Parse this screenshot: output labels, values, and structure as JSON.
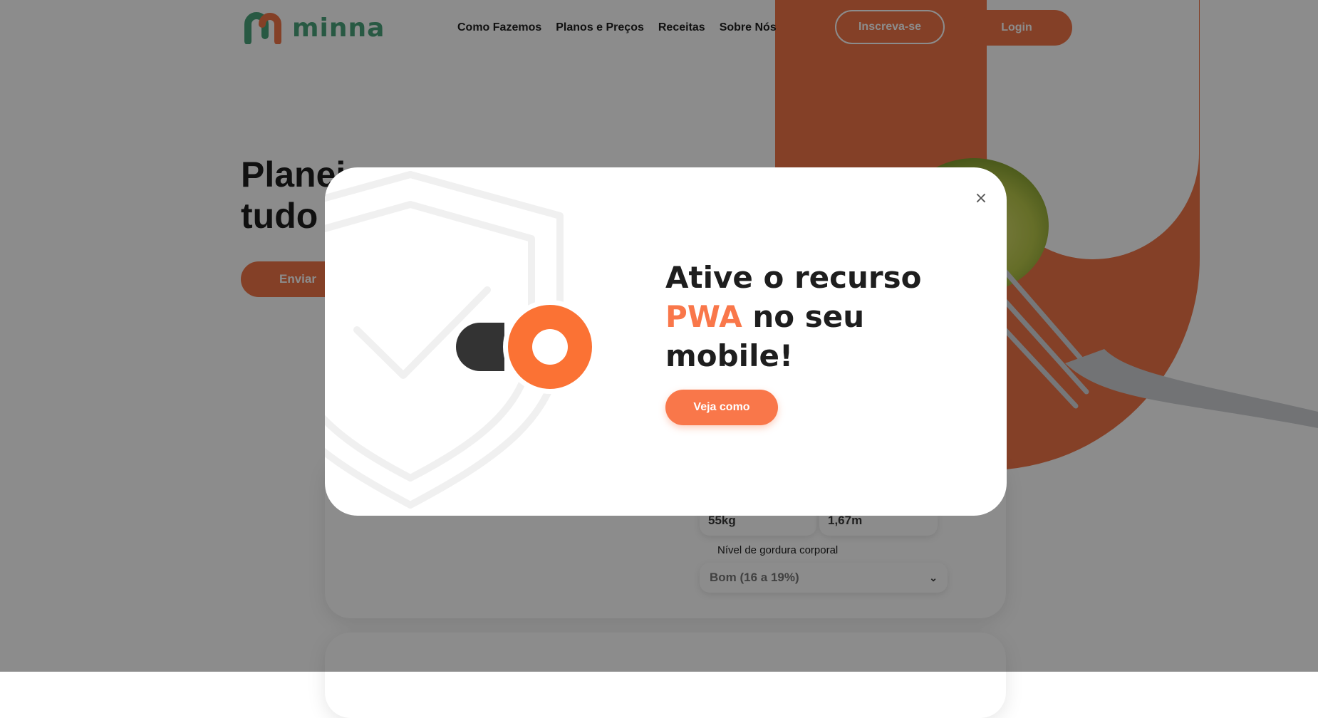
{
  "header": {
    "logo_text": "minna",
    "nav": [
      "Como Fazemos",
      "Planos e Preços",
      "Receitas",
      "Sobre Nós"
    ],
    "signup_label": "Inscreva-se",
    "login_label": "Login"
  },
  "hero": {
    "title_line1": "Planej",
    "title_line2": "tudo c",
    "submit_label": "Enviar"
  },
  "form": {
    "weight_value": "55kg",
    "height_value": "1,67m",
    "fat_label": "Nível de gordura corporal",
    "fat_value": "Bom (16 a 19%)"
  },
  "modal": {
    "title_part1": "Ative o recurso",
    "title_accent": "PWA",
    "title_part2": "no seu mobile!",
    "cta_label": "Veja como",
    "close_symbol": "×"
  },
  "icons": {
    "close": "close-icon",
    "chevron": "chevron-down-icon",
    "shield": "shield-check-icon",
    "toggle": "toggle-on-icon"
  },
  "colors": {
    "accent": "#f9774a",
    "brand_green": "#4aa37a",
    "text_dark": "#1e1e1e",
    "overlay": "rgba(0,0,0,0.45)"
  }
}
